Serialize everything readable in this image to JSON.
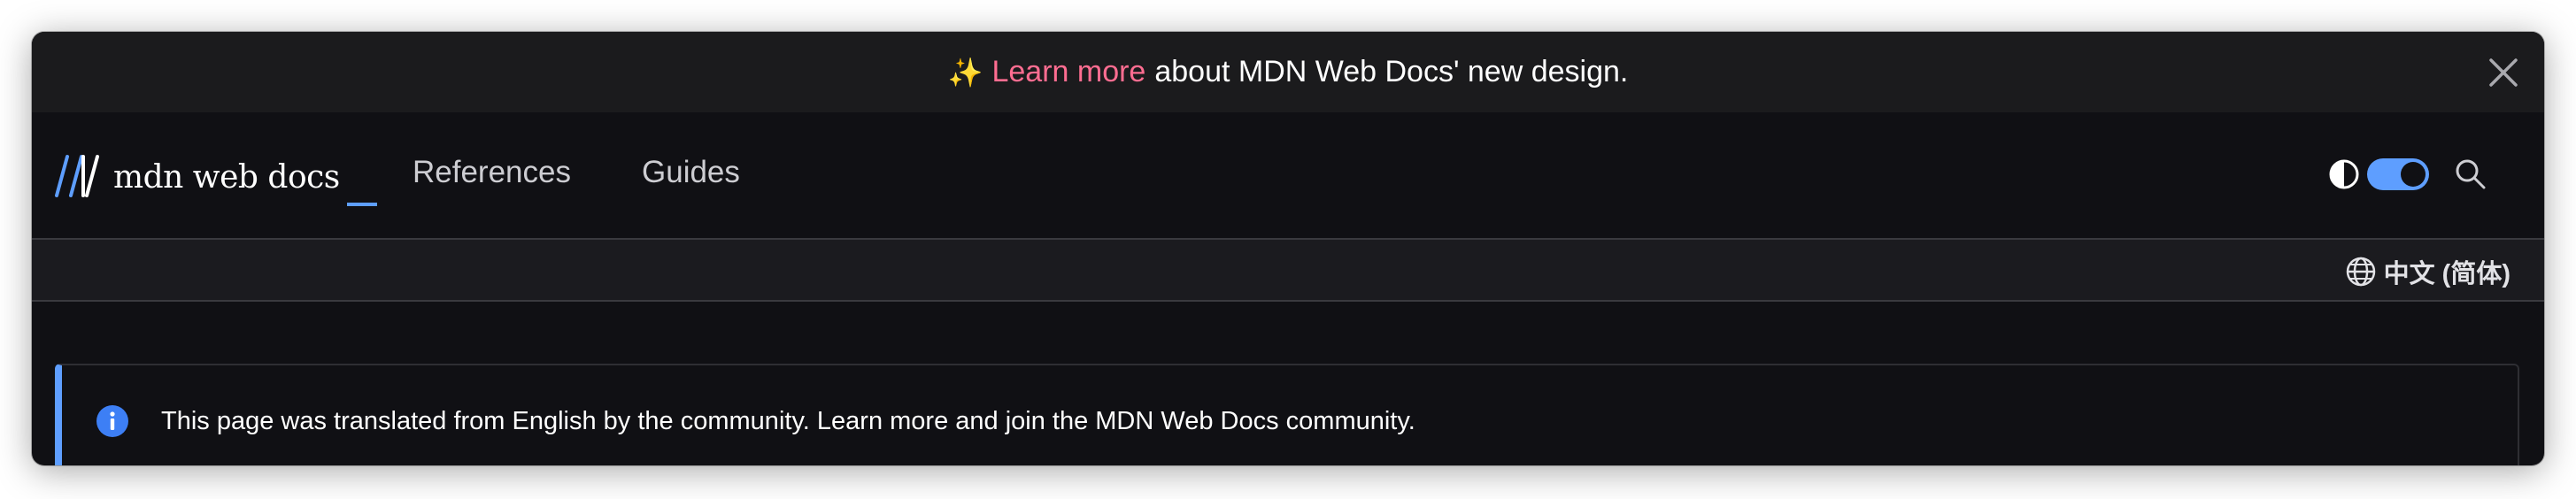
{
  "banner": {
    "sparkle": "✨",
    "link_text": "Learn more",
    "rest_text": "about MDN Web Docs' new design.",
    "link_color": "#ff6d91"
  },
  "header": {
    "logo_text": "mdn web docs",
    "nav": [
      {
        "label": "References"
      },
      {
        "label": "Guides"
      }
    ],
    "accent_color": "#5e9eff"
  },
  "language": {
    "label": "中文 (简体)"
  },
  "notice": {
    "text": "This page was translated from English by the community. Learn more and join the MDN Web Docs community."
  },
  "icons": {
    "banner_close": "close-icon",
    "theme": "contrast-icon",
    "search": "search-icon",
    "language": "globe-icon",
    "notice": "info-icon"
  }
}
